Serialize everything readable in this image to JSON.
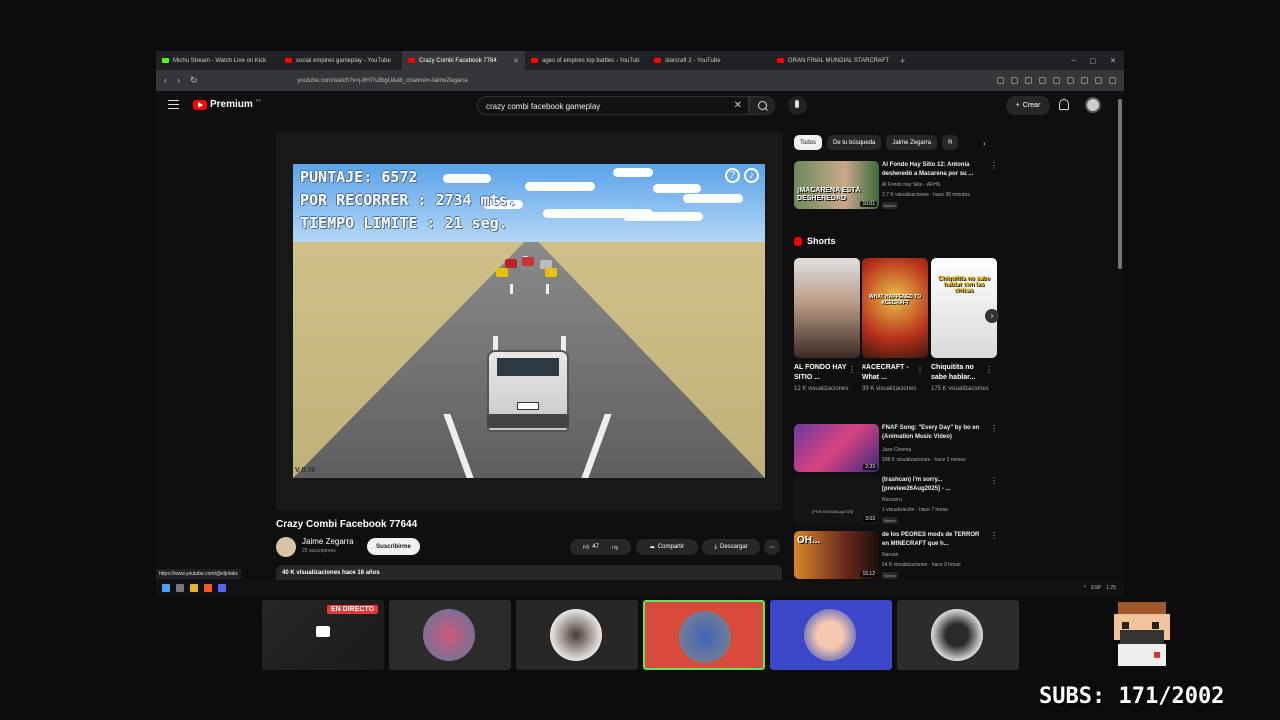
{
  "browser": {
    "tabs": [
      {
        "label": "Michu Stream - Watch Live on Kick",
        "color": "#53fc18"
      },
      {
        "label": "social empires gameplay - YouTube",
        "color": "#ff0000"
      },
      {
        "label": "Crazy Combi Facebook 7764",
        "color": "#ff0000",
        "active": true
      },
      {
        "label": "ages of empires top battles - YouTub",
        "color": "#ff0000"
      },
      {
        "label": "starcraft 2 - YouTube",
        "color": "#ff0000"
      },
      {
        "label": "GRAN FINAL MUNDIAL STARCRAFT",
        "color": "#ff0000"
      }
    ],
    "new_tab": "+",
    "url": "youtube.com/watch?v=j-8H7nJlbgU&ab_channel=JaimeZegarra"
  },
  "youtube": {
    "logo": "Premium",
    "logo_sup": "PE",
    "search_value": "crazy combi facebook gameplay",
    "create_label": "Crear",
    "video_title": "Crazy Combi Facebook 77644",
    "channel_name": "Jaime Zegarra",
    "channel_subs": "25 suscriptores",
    "subscribe": "Suscribirme",
    "likes": "47",
    "share": "Compartir",
    "download": "Descargar",
    "desc_meta": "40 K visualizaciones  hace 16 años",
    "hover_link": "https://www.youtube.com/@eljotalis"
  },
  "game": {
    "score": "PUNTAJE: 6572",
    "distance": "POR RECORRER : 2734 mts.",
    "time": "TIEMPO LIMITE : 21  seg.",
    "version": "V 0.38"
  },
  "chips": [
    "Todos",
    "De tu búsqueda",
    "Jaime Zegarra",
    "R"
  ],
  "recommended_top": {
    "title": "Al Fondo Hay Sitio 12: Antonia desheredó a Macarena por su ...",
    "channel": "Al Fondo hay Sitio · AFHS",
    "meta": "2,7 K visualizaciones · hace 38 minutos",
    "badge": "Nuevo",
    "thumb_text": "¡MACARENA ESTÁ DESHEREDAD",
    "duration": "10:01"
  },
  "shorts_heading": "Shorts",
  "shorts": [
    {
      "title": "AL FONDO HAY SITIO ...",
      "views": "12 K visualizaciones"
    },
    {
      "title": "#ACECRAFT - What ...",
      "views": "39 K visualizaciones",
      "thumb_text": "WHAT HAPPENED TO ACECRAFT"
    },
    {
      "title": "Chiquitita no sabe hablar...",
      "views": "175 K visualizaciones",
      "thumb_text": "Chiquitita no sabe hablar con las chicas"
    }
  ],
  "recommended": [
    {
      "title": "FNAF Song: \"Every Day\" by bo en (Animation Music Video)",
      "channel": "Jaze Cinema",
      "meta": "938 K visualizaciones · hace 2 meses",
      "duration": "2:33"
    },
    {
      "title": "(trashcan) i'm sorry... [preview26Aug2025] - ...",
      "channel": "Nicoxeru",
      "meta": "1 visualización · hace 7 horas",
      "badge": "Nuevo",
      "duration": "3:03",
      "thumb_text": "[PREVIEW26Aug2025]"
    },
    {
      "title": "de los PEORES mods de TERROR en MINECRAFT que h...",
      "channel": "Naruan",
      "meta": "64 K visualizaciones · hace 9 horas",
      "badge": "Nuevo",
      "duration": "15:12",
      "thumb_text": "OH..."
    }
  ],
  "taskbar": {
    "lang": "ESP",
    "time": "1:25"
  },
  "stream": {
    "live_label": "EN DIRECTO",
    "subs": "SUBS: 171/2002"
  },
  "colors": {
    "yt_red": "#ff0000",
    "accent_red": "#d84a3a",
    "accent_blue": "#3b46c8"
  }
}
